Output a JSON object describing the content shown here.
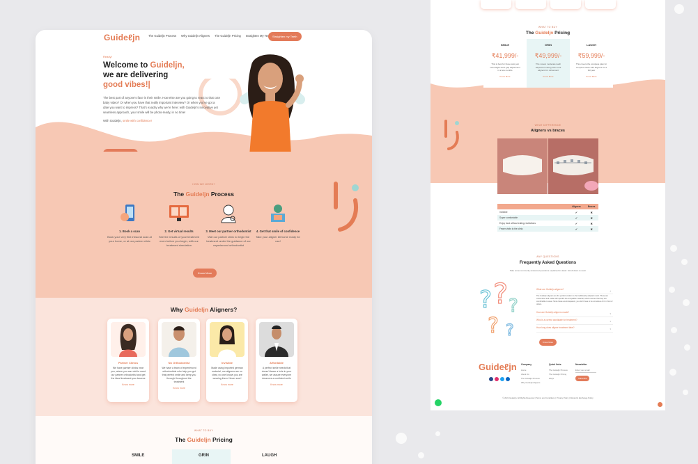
{
  "brand": {
    "logo": "Guideℓjn",
    "accent": "#e47c55",
    "peach": "#f7c8b4",
    "mint": "#e8f5f5"
  },
  "nav": {
    "links": [
      "The Guideljn Process",
      "Why Guideljn Aligners",
      "The Guideljn Pricing",
      "Straighten My Teeth"
    ],
    "cta": "Straighten my Teeth"
  },
  "hero": {
    "eyebrow": "Ready!",
    "line1_pre": "Welcome to ",
    "line1_acc": "Guideljn,",
    "line2": "we are delivering",
    "line3": "good vibes!|",
    "paragraph": "The best part of anyone's face is their smile. How else are you going to react to that cute baby video? Or when you have that really important interview? Or when you've got a date you want to impress? That's exactly why we're here: with Guideljn's innovative yet seamless approach, your smile will be photo-ready, in no time!",
    "tagline_pre": "With Guideljn, ",
    "tagline_acc": "smile with confidence!",
    "button": "Straighten My Teeth"
  },
  "process": {
    "label": "HOW WE WORK?",
    "title_pre": "The ",
    "title_acc": "Guideljn",
    "title_post": " Process",
    "steps": [
      {
        "icon": "phone-scan-icon",
        "title": "1. Book a scan",
        "text": "Book your very first intraoral scan at your home, or at our partner clinic"
      },
      {
        "icon": "monitor-results-icon",
        "title": "2. Get virtual results",
        "text": "See the results of your treatment even before you begin, with our treatment simulation"
      },
      {
        "icon": "orthodontist-icon",
        "title": "3. Meet our partner orthodontist",
        "text": "Visit our partner clinic to begin the treatment under the guidance of our experienced orthodontist"
      },
      {
        "icon": "delivery-box-icon",
        "title": "4. Get that smile of confidence",
        "text": "Take your aligner kit home ready for use!"
      }
    ],
    "button": "Know More"
  },
  "why": {
    "title_pre": "Why ",
    "title_acc": "Guideljn",
    "title_post": " Aligners?",
    "cards": [
      {
        "title": "Partner Clinics",
        "text": "We have partner clinics near you, where you can visit to meet our partner orthodontist and get the ideal treatment you deserve",
        "more": "Know more"
      },
      {
        "title": "No Orthodontist",
        "text": "We have a team of experienced orthodontists who help you get that perfect smile and keep you through throughout the treatment",
        "more": "Know more"
      },
      {
        "title": "Invisible",
        "text": "Made using imported german material, our aligners are so clear, no one knows you are wearing them. Never ever!",
        "more": "Know more"
      },
      {
        "title": "Affordable",
        "text": "A perfect smile needs that doesn't leave a hole in your wallet, we assure everyone deserves a confident smile",
        "more": "Know more"
      }
    ]
  },
  "pricing": {
    "label": "WHAT TO BUY",
    "title_pre": "The ",
    "title_acc": "Guideljn",
    "title_post": " Pricing",
    "plans": [
      {
        "name": "SMILE",
        "price": "₹41,999/-",
        "desc": "This is best for those who just need slight teeth gap adjustment in a few months",
        "more": "Know More"
      },
      {
        "name": "GRIN",
        "price": "₹49,999/-",
        "desc": "This covers moderate teeth adjustment along with extra aligners for refinement",
        "more": "Know More"
      },
      {
        "name": "LAUGH",
        "price": "₹59,999/-",
        "desc": "This covers the complete plan for complex cases with aligners for a full year",
        "more": "Know More"
      }
    ]
  },
  "compare": {
    "label": "WHAT DIFFERENCE",
    "title": "Aligners vs braces",
    "headers": [
      "",
      "Aligners",
      "Braces"
    ],
    "rows": [
      {
        "feature": "Invisible",
        "aligners": "✔",
        "braces": "✖"
      },
      {
        "feature": "Super comfortable",
        "aligners": "✔",
        "braces": "✖"
      },
      {
        "feature": "Enjoy food without eating restrictions",
        "aligners": "✔",
        "braces": "✖"
      },
      {
        "feature": "Fewer visits to the clinic",
        "aligners": "✔",
        "braces": "✖"
      }
    ]
  },
  "faq": {
    "label": "ANY QUESTIONS",
    "title": "Frequently Asked Questions",
    "subtitle": "Take some commonly answered questions explained in detail. Scroll down to read.",
    "items": [
      {
        "q": "What are Guideljn aligners?"
      },
      {
        "q": "How are Guideljn aligners made?"
      },
      {
        "q": "Who is a correct candidate for treatment?"
      },
      {
        "q": "How long does aligner treatment take?"
      }
    ],
    "open_answer": "The Guideljn aligners are the perfect solution to the traditionally adapted metal. These are customized and made with specific bio-compatible material, which ensures that they are comfortable to wear. Since these are transparent, you don't have to be conscious of it in front of others.",
    "button": "Know More"
  },
  "footer": {
    "col1_h": "Company",
    "col1": [
      "Home",
      "About Us",
      "The Guideljn Process",
      "Why Guideljn Aligners"
    ],
    "col2_h": "Quick links",
    "col2": [
      "The Guideljn Process",
      "The Guideljn Pricing",
      "FAQs"
    ],
    "col3_h": "Newsletter",
    "col3_placeholder": "Enter your email",
    "col3_button": "Subscribe",
    "copyright": "© 2021 Guideljn. All Rights Reserved  |  Terms and Conditions  |  Privacy Policy  |  Refund & Exchange Policy"
  }
}
